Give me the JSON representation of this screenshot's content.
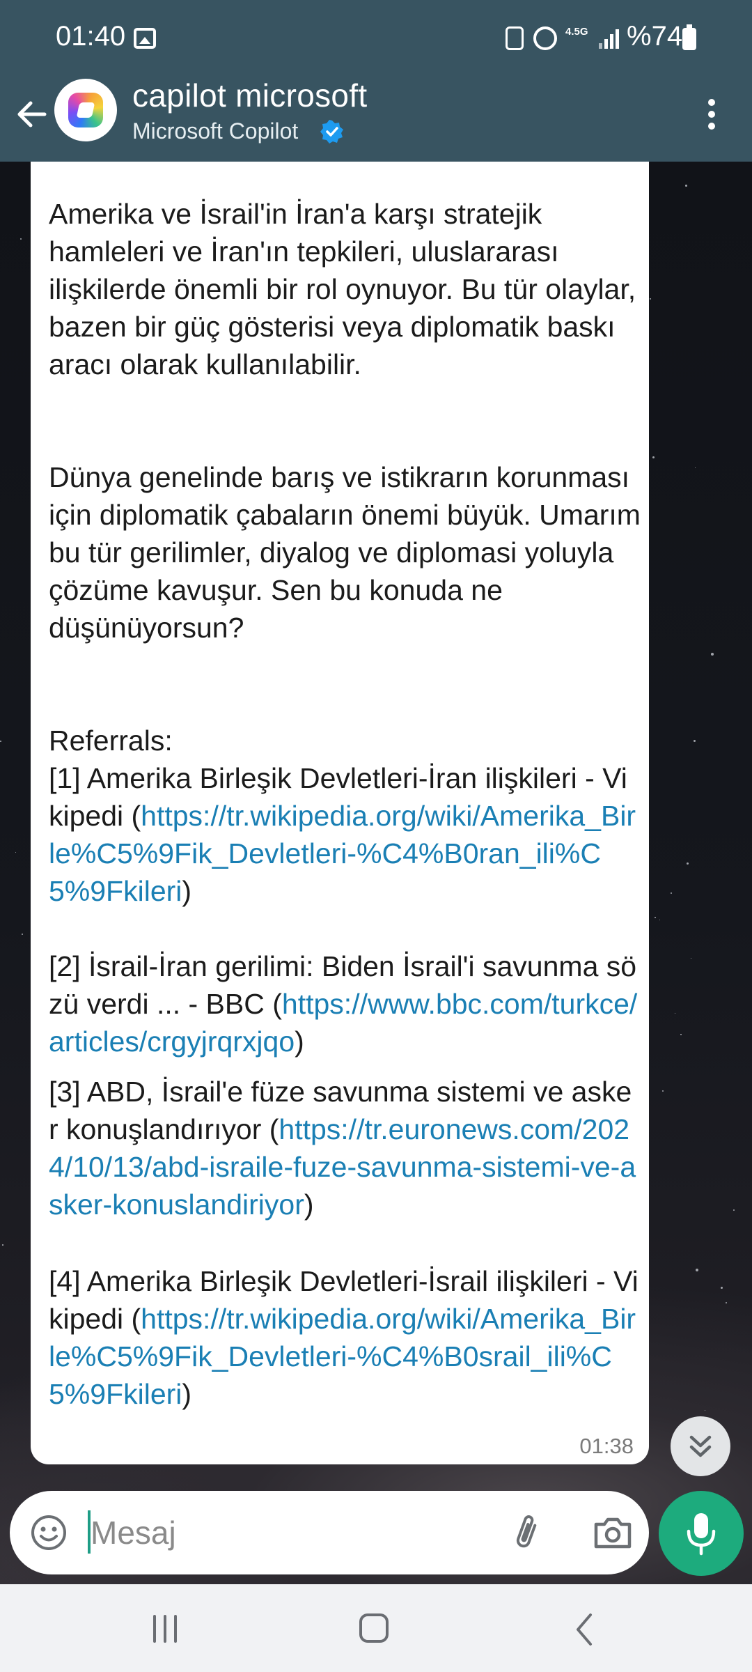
{
  "status_bar": {
    "time": "01:40",
    "network": "4.5G",
    "battery": "%74"
  },
  "header": {
    "chat_name": "capilot microsoft",
    "subtitle": "Microsoft Copilot"
  },
  "message": {
    "paragraph_1": "Amerika ve İsrail'in İran'a karşı stratejik hamleleri ve İran'ın tepkileri, uluslararası ilişkilerde önemli bir rol oynuyor. Bu tür olaylar, bazen bir güç gösterisi veya diplomatik baskı aracı olarak kullanılabilir.",
    "paragraph_2": "Dünya genelinde barış ve istikrarın korunması için diplomatik çabaların önemi büyük. Umarım bu tür gerilimler, diyalog ve diplomasi yoluyla çözüme kavuşur. Sen bu konuda ne düşünüyorsun?",
    "referrals_heading": "Referrals:",
    "references": [
      {
        "text": "[1] Amerika Birleşik Devletleri-İran ilişkileri - Vikipedi (",
        "url": "https://tr.wikipedia.org/wiki/Amerika_Birle%C5%9Fik_Devletleri-%C4%B0ran_ili%C5%9Fkileri",
        "close": ")"
      },
      {
        "text": "[2] İsrail-İran gerilimi: Biden İsrail'i savunma sözü verdi ... - BBC (",
        "url": "https://www.bbc.com/turkce/articles/crgyjrqrxjqo",
        "close": ")"
      },
      {
        "text": "[3] ABD, İsrail'e füze savunma sistemi ve asker konuşlandırıyor (",
        "url": "https://tr.euronews.com/2024/10/13/abd-israile-fuze-savunma-sistemi-ve-asker-konuslandiriyor",
        "close": ")"
      },
      {
        "text": "[4] Amerika Birleşik Devletleri-İsrail ilişkileri - Vikipedi (",
        "url": "https://tr.wikipedia.org/wiki/Amerika_Birle%C5%9Fik_Devletleri-%C4%B0srail_ili%C5%9Fkileri",
        "close": ")"
      }
    ],
    "time": "01:38"
  },
  "composer": {
    "placeholder": "Mesaj"
  },
  "colors": {
    "header_bg": "#385461",
    "link": "#1a7fb4",
    "mic_button": "#1dab7d"
  }
}
